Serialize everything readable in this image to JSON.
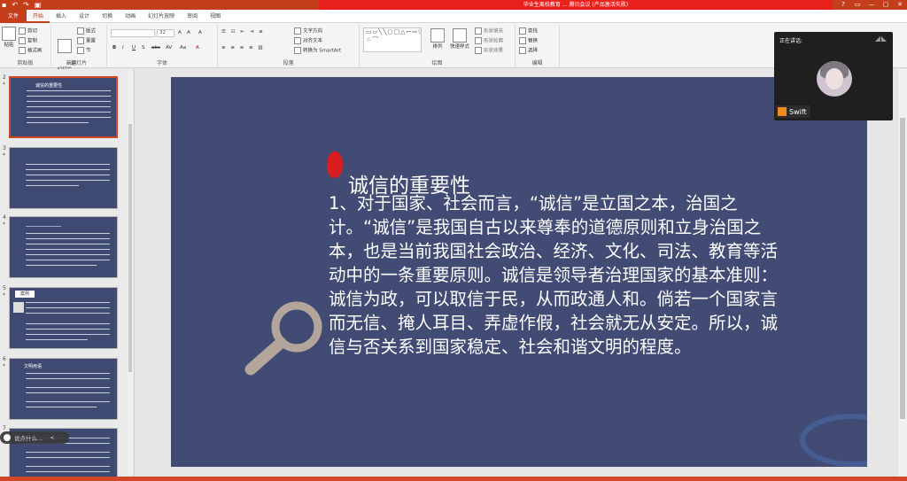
{
  "title_bar": {
    "document_title": "毕业生离校教育 ... 腾讯会议 (产品激活失败)",
    "quick_access": [
      "save-icon",
      "undo-icon",
      "redo-icon",
      "present-icon"
    ],
    "window_controls": [
      "?",
      "▭",
      "—",
      "▢",
      "✕"
    ]
  },
  "tabs": [
    "文件",
    "开始",
    "插入",
    "设计",
    "切换",
    "动画",
    "幻灯片放映",
    "审阅",
    "视图"
  ],
  "active_tab": "开始",
  "ribbon": {
    "clipboard": {
      "paste": "粘贴",
      "cut": "剪切",
      "copy": "复制",
      "format_painter": "格式刷",
      "label": "剪贴板"
    },
    "slides": {
      "new_slide": "新建\n幻灯片",
      "layout": "版式",
      "reset": "重置",
      "section": "节",
      "label": "幻灯片"
    },
    "font": {
      "font_size": "32",
      "bold": "B",
      "italic": "I",
      "underline": "U",
      "shadow": "S",
      "strike": "abc",
      "spacing": "AV",
      "case": "Aa",
      "color": "A",
      "grow": "A",
      "shrink": "A",
      "clear": "A",
      "label": "字体"
    },
    "paragraph": {
      "text_direction": "文字方向",
      "align_text": "对齐文本",
      "smartart": "转换为 SmartArt",
      "label": "段落"
    },
    "drawing": {
      "arrange": "排列",
      "quick_styles": "快速样式",
      "shape_fill": "形状填充",
      "shape_outline": "形状轮廓",
      "shape_effects": "形状效果",
      "label": "绘图"
    },
    "editing": {
      "find": "查找",
      "replace": "替换",
      "select": "选择",
      "label": "编辑"
    }
  },
  "thumbnails": [
    {
      "num": "2",
      "star": "*",
      "title": "诚信的重要性"
    },
    {
      "num": "3",
      "star": "*"
    },
    {
      "num": "4",
      "star": "*"
    },
    {
      "num": "5",
      "star": "*",
      "title": "案例"
    },
    {
      "num": "6",
      "star": "*",
      "title": "文明用语"
    },
    {
      "num": "7",
      "star": "*"
    }
  ],
  "slide": {
    "title": "诚信的重要性",
    "body": "1、对于国家、社会而言，“诚信”是立国之本，治国之计。“诚信”是我国自古以来尊奉的道德原则和立身治国之本，也是当前我国社会政治、经济、文化、司法、教育等活动中的一条重要原则。诚信是领导者治理国家的基本准则：诚信为政，可以取信于民，从而政通人和。倘若一个国家言而无信、掩人耳目、弄虚作假，社会就无从安定。所以，诚信与否关系到国家稳定、社会和谐文明的程度。"
  },
  "meeting": {
    "speaking_label": "正在讲话:",
    "speaker_name": "Swift"
  },
  "overlay_pill": {
    "text": "说点什么...",
    "arrow": "<"
  },
  "colors": {
    "accent": "#c43e1c",
    "slide_bg": "#414b74",
    "title_red": "#e8211c"
  }
}
